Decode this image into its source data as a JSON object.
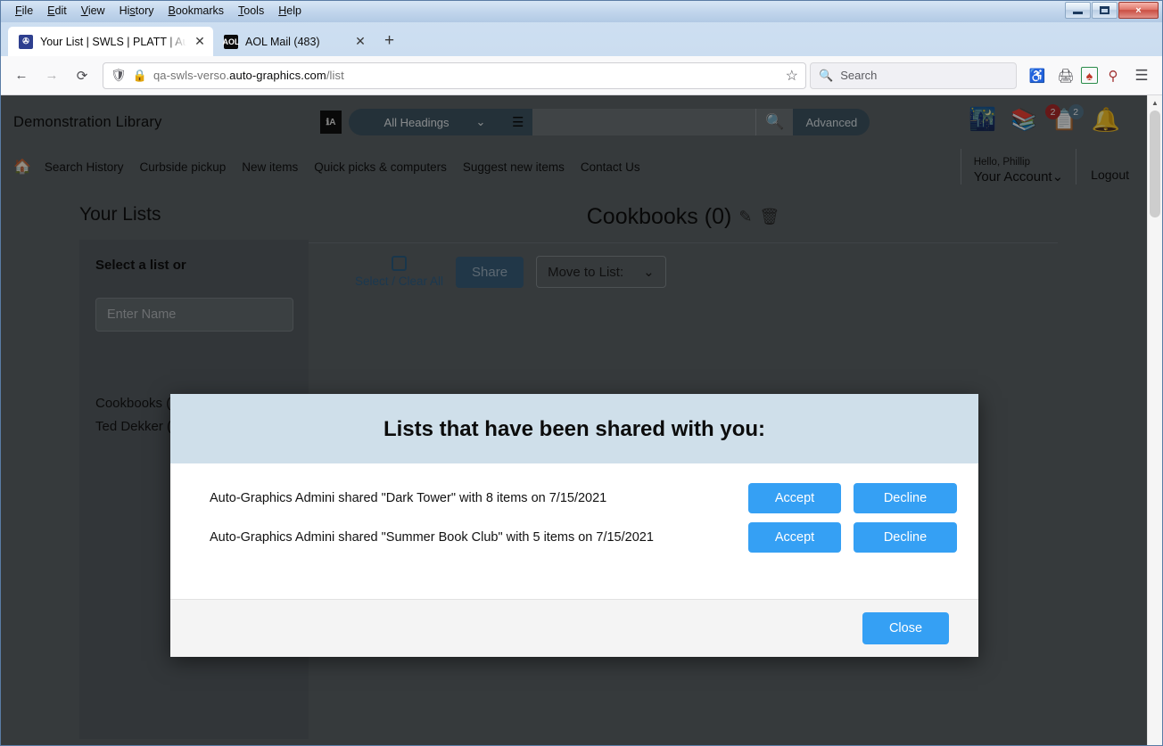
{
  "browser": {
    "menus": [
      "File",
      "Edit",
      "View",
      "History",
      "Bookmarks",
      "Tools",
      "Help"
    ],
    "window_controls": {
      "minimize": "minimize-icon",
      "maximize": "maximize-icon",
      "close": "×"
    },
    "tabs": [
      {
        "title": "Your List | SWLS | PLATT | Auto-",
        "favicon": "verso-icon",
        "favicon_text": "✇",
        "close": "✕",
        "active": true
      },
      {
        "title": "AOL Mail (483)",
        "favicon": "aol-icon",
        "favicon_text": "AOL",
        "close": "✕",
        "active": false
      }
    ],
    "new_tab_label": "+",
    "nav": {
      "back": "←",
      "forward": "→",
      "reload": "⟳",
      "shield_icon": "shield-icon",
      "lock_icon": "broken-lock-icon",
      "url_prefix": "qa-swls-verso.",
      "url_domain": "auto-graphics.com",
      "url_path": "/list",
      "bookmark_star": "☆"
    },
    "search": {
      "placeholder": "Search",
      "icon": "search-icon"
    },
    "toolbar_icons": [
      "pocket-icon",
      "print-icon",
      "shield-extension-icon",
      "search-extension-icon",
      "hamburger-menu-icon"
    ]
  },
  "app": {
    "library_name": "Demonstration Library",
    "search": {
      "language_icon": "translate-icon",
      "scope_label": "All Headings",
      "scope_caret": "⌄",
      "database_icon": "database-icon",
      "query_value": "",
      "search_icon": "search-icon",
      "advanced_label": "Advanced"
    },
    "header_icons": {
      "balloon": "hot-air-balloon-icon",
      "shelf": "browse-shelf-icon",
      "list_badge_left": "2",
      "list_badge_right": "2",
      "list_icon": "saved-lists-icon",
      "bell_icon": "notifications-bell-icon"
    },
    "nav_links": [
      "Search History",
      "Curbside pickup",
      "New items",
      "Quick picks & computers",
      "Suggest new items",
      "Contact Us"
    ],
    "home_icon": "home-icon",
    "account": {
      "greeting": "Hello, Phillip",
      "account_label": "Your Account",
      "caret": "⌄",
      "logout_label": "Logout"
    }
  },
  "page": {
    "heading": "Your Lists",
    "panel": {
      "title": "Select a list or",
      "input_placeholder": "Enter Name",
      "saved_lists": [
        "Cookbooks (",
        "Ted Dekker ("
      ]
    },
    "content": {
      "title": "Cookbooks (0)",
      "edit_icon": "edit-list-icon",
      "delete_icon": "delete-list-icon",
      "select_clear_label": "Select / Clear All",
      "checkbox_icon": "select-all-checkbox",
      "share_label": "Share",
      "move_to_list_label": "Move to List:",
      "move_caret": "⌄"
    }
  },
  "modal": {
    "title": "Lists that have been shared with you:",
    "rows": [
      {
        "text": "Auto-Graphics Admini shared \"Dark Tower\" with 8 items on 7/15/2021",
        "accept_label": "Accept",
        "decline_label": "Decline"
      },
      {
        "text": "Auto-Graphics Admini shared \"Summer Book Club\" with 5 items on 7/15/2021",
        "accept_label": "Accept",
        "decline_label": "Decline"
      }
    ],
    "close_label": "Close"
  },
  "colors": {
    "accent_blue": "#35a0f4",
    "modal_header": "#cfdfea",
    "app_header": "#5d6468",
    "search_pill": "#3f5562",
    "badge_red": "#b02a2a",
    "badge_blue": "#56778c"
  }
}
